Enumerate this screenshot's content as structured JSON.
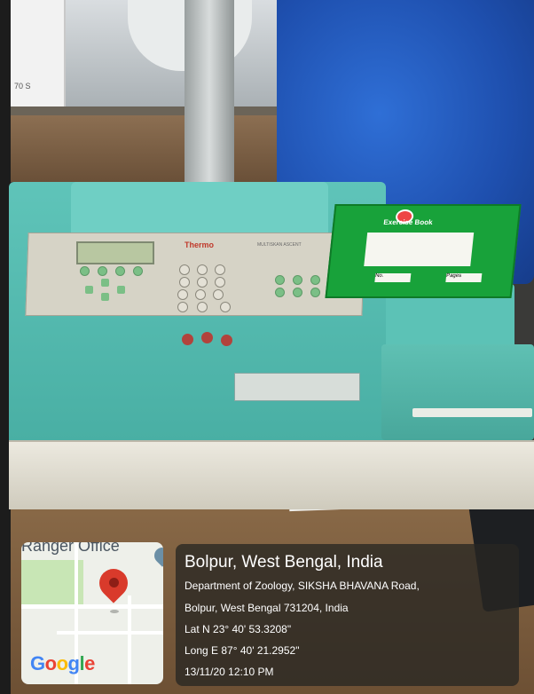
{
  "photo": {
    "instrument_brand": "Thermo",
    "instrument_model": "MULTISKAN ASCENT",
    "shelf_label": "70 S",
    "notebook": {
      "title": "Exercise Book",
      "no_label": "No.",
      "page_label": "Pages"
    }
  },
  "map": {
    "place_label": "Ranger Office",
    "logo": "Google",
    "pin_color": "#d93a2b",
    "logo_colors": [
      "#4285f4",
      "#ea4335",
      "#fbbc05",
      "#4285f4",
      "#34a853",
      "#ea4335"
    ]
  },
  "location": {
    "title": "Bolpur, West Bengal, India",
    "line1": "Department of Zoology, SIKSHA BHAVANA Road,",
    "line2": "Bolpur, West Bengal 731204, India",
    "lat": "Lat N 23° 40' 53.3208\"",
    "long": "Long E 87° 40' 21.2952\"",
    "datetime": "13/11/20 12:10 PM"
  }
}
